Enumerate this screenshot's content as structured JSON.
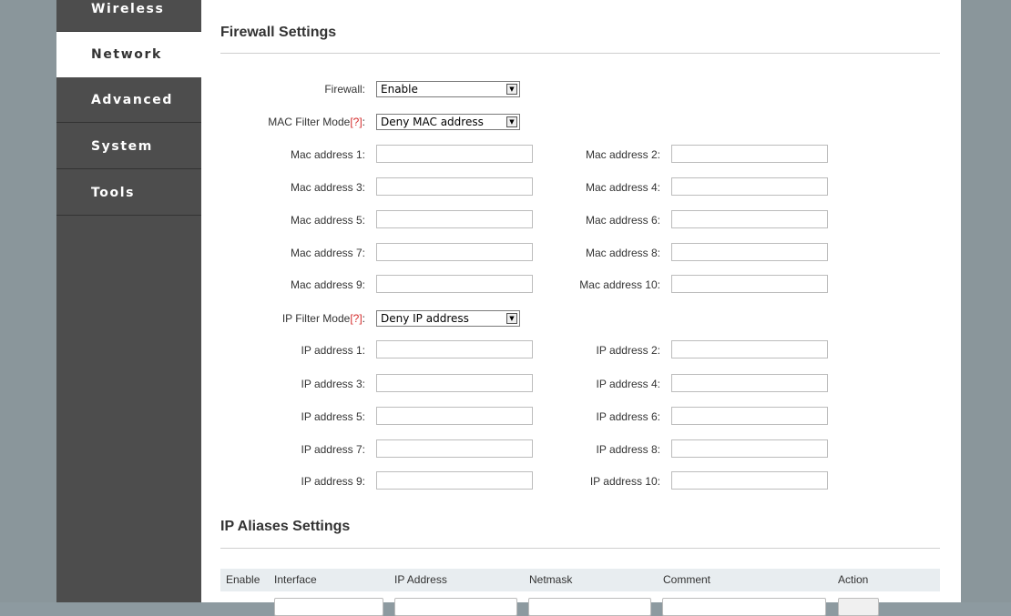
{
  "sidebar": {
    "items": [
      {
        "label": "Wireless"
      },
      {
        "label": "Network"
      },
      {
        "label": "Advanced"
      },
      {
        "label": "System"
      },
      {
        "label": "Tools"
      }
    ],
    "active": "Network"
  },
  "firewall": {
    "title": "Firewall Settings",
    "firewall_label": "Firewall:",
    "firewall_value": "Enable",
    "mac_mode_label": "MAC Filter Mode",
    "help_hint": "[?]",
    "mac_mode_value": "Deny MAC address",
    "mac_addresses": [
      {
        "label": "Mac address 1:",
        "value": ""
      },
      {
        "label": "Mac address 2:",
        "value": ""
      },
      {
        "label": "Mac address 3:",
        "value": ""
      },
      {
        "label": "Mac address 4:",
        "value": ""
      },
      {
        "label": "Mac address 5:",
        "value": ""
      },
      {
        "label": "Mac address 6:",
        "value": ""
      },
      {
        "label": "Mac address 7:",
        "value": ""
      },
      {
        "label": "Mac address 8:",
        "value": ""
      },
      {
        "label": "Mac address 9:",
        "value": ""
      },
      {
        "label": "Mac address 10:",
        "value": ""
      }
    ],
    "ip_mode_label": "IP Filter Mode",
    "ip_mode_value": "Deny IP address",
    "ip_addresses": [
      {
        "label": "IP address 1:",
        "value": ""
      },
      {
        "label": "IP address 2:",
        "value": ""
      },
      {
        "label": "IP address 3:",
        "value": ""
      },
      {
        "label": "IP address 4:",
        "value": ""
      },
      {
        "label": "IP address 5:",
        "value": ""
      },
      {
        "label": "IP address 6:",
        "value": ""
      },
      {
        "label": "IP address 7:",
        "value": ""
      },
      {
        "label": "IP address 8:",
        "value": ""
      },
      {
        "label": "IP address 9:",
        "value": ""
      },
      {
        "label": "IP address 10:",
        "value": ""
      }
    ]
  },
  "aliases": {
    "title": "IP Aliases Settings",
    "columns": [
      "Enable",
      "Interface",
      "IP Address",
      "Netmask",
      "Comment",
      "Action"
    ]
  },
  "colors": {
    "sidebar_bg": "#4d4d4d",
    "page_bg": "#8a969b",
    "hint": "#d42d2d",
    "table_header_bg": "#e8edf0"
  }
}
